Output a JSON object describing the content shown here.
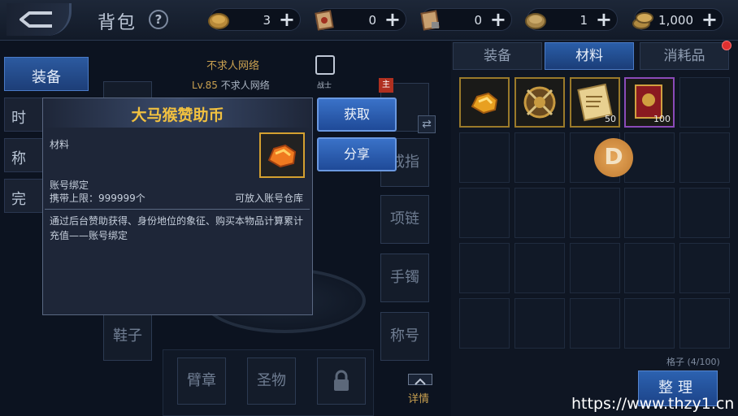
{
  "header": {
    "title": "背包",
    "help_icon": "question-icon",
    "resources": [
      {
        "icon": "gold-coin-icon",
        "value": "3"
      },
      {
        "icon": "scroll-icon",
        "value": "0"
      },
      {
        "icon": "scroll-lock-icon",
        "value": "0"
      },
      {
        "icon": "silver-coin-icon",
        "value": "1"
      },
      {
        "icon": "coin-stack-icon",
        "value": "1,000"
      }
    ],
    "plus": "+"
  },
  "left_tabs": [
    "装备",
    "时",
    "称",
    "完"
  ],
  "character": {
    "name": "不求人网络",
    "level_prefix": "Lv.85",
    "level_name": "不求人网络",
    "class_label": "战士",
    "main_tag": "主"
  },
  "slots": {
    "ring": "戒指",
    "necklace": "项链",
    "bracelet": "手镯",
    "title": "称号",
    "shoes": "鞋子",
    "armband": "臂章",
    "relic": "圣物"
  },
  "detail_label": "详情",
  "right_tabs": [
    "装备",
    "材料",
    "消耗品"
  ],
  "bag_items": [
    {
      "name": "大马猴赞助币",
      "count": ""
    },
    {
      "name": "medal",
      "count": ""
    },
    {
      "name": "scroll",
      "count": "50"
    },
    {
      "name": "book",
      "count": "100"
    }
  ],
  "dcoin_label": "D",
  "slot_count": "格子 (4/100)",
  "sort_button": "整理",
  "popup": {
    "title": "大马猴赞助币",
    "category": "材料",
    "bind": "账号绑定",
    "carry_limit": "携带上限：999999个",
    "storage": "可放入账号仓库",
    "description": "通过后台赞助获得、身份地位的象征、购买本物品计算累计充值——账号绑定",
    "get_button": "获取",
    "share_button": "分享"
  },
  "watermark": "https://www.thzy1.cn",
  "colors": {
    "accent_blue": "#2c5aa0",
    "gold": "#f0c040",
    "bg": "#0c1320"
  }
}
